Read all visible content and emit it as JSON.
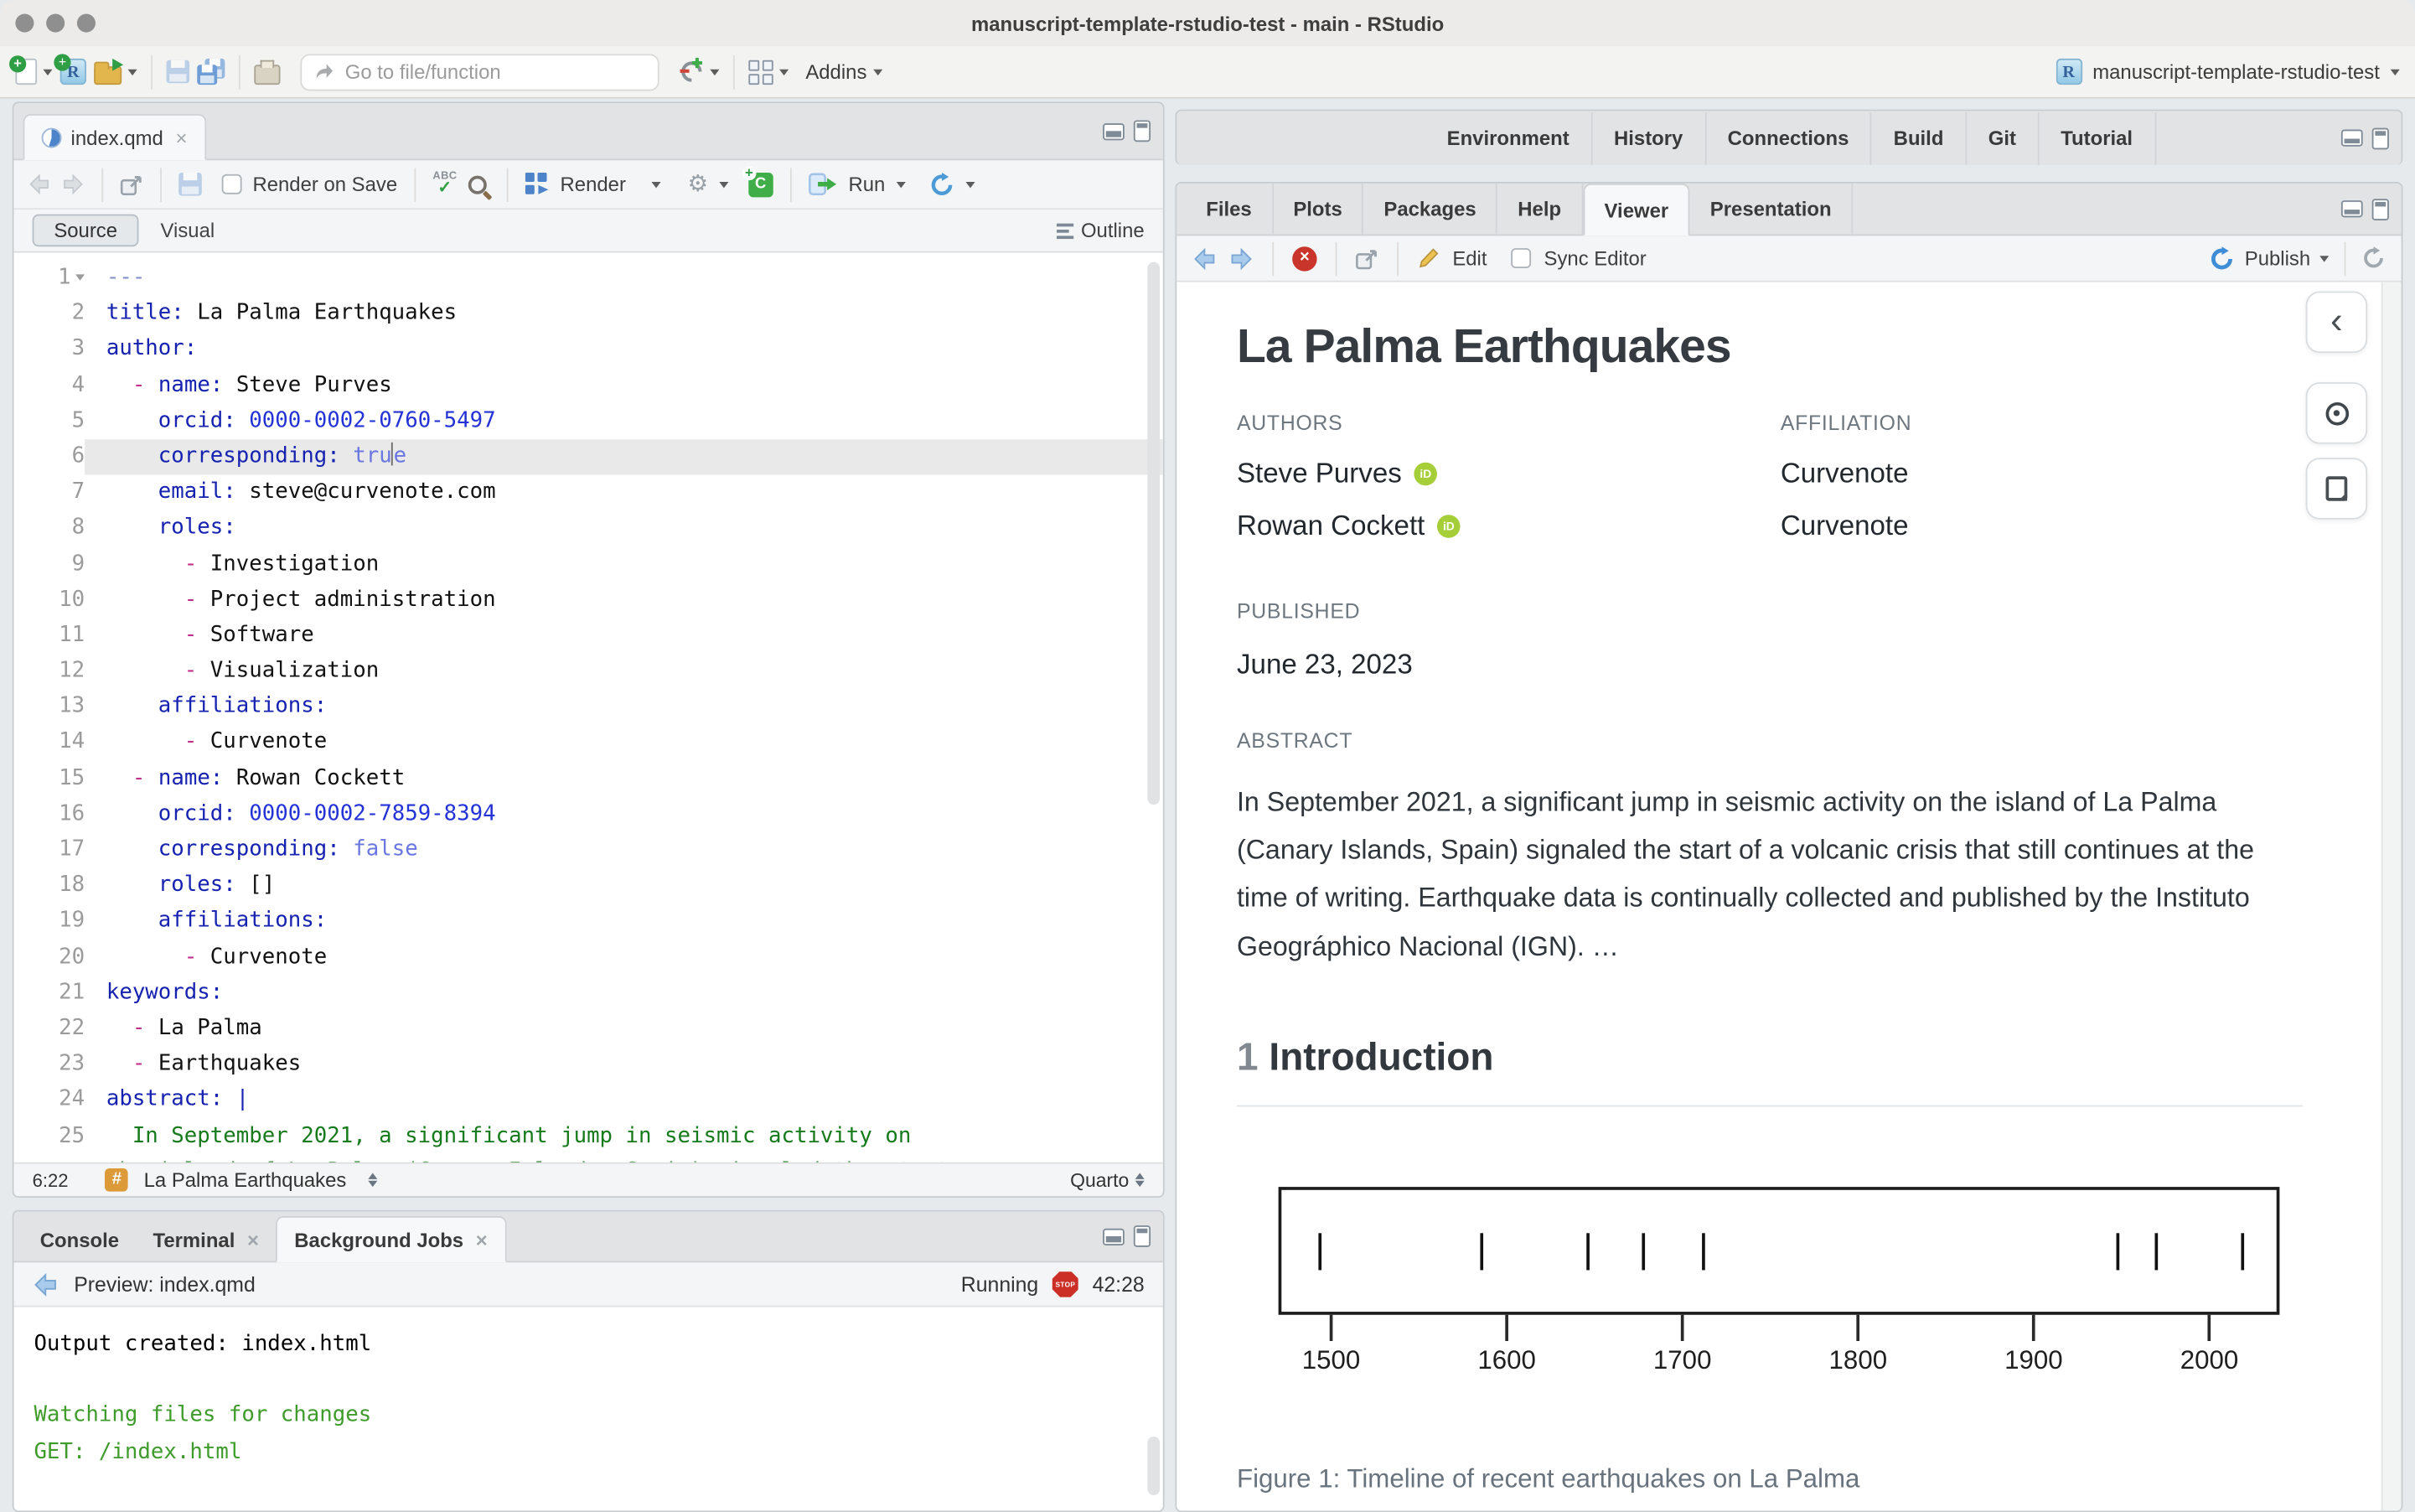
{
  "window": {
    "title": "manuscript-template-rstudio-test - main - RStudio"
  },
  "main_toolbar": {
    "goto_placeholder": "Go to file/function",
    "addins_label": "Addins",
    "project_name": "manuscript-template-rstudio-test"
  },
  "editor": {
    "tab_title": "index.qmd",
    "toolbar": {
      "render_on_save_label": "Render on Save",
      "render_label": "Render",
      "run_label": "Run"
    },
    "mode": {
      "source_label": "Source",
      "visual_label": "Visual",
      "outline_label": "Outline"
    },
    "status": {
      "cursor_position": "6:22",
      "section_label": "La Palma Earthquakes",
      "format_label": "Quarto"
    },
    "lines": [
      {
        "n": 1,
        "fold": true,
        "tokens": [
          {
            "t": "---",
            "c": "meta"
          }
        ]
      },
      {
        "n": 2,
        "tokens": [
          {
            "t": "title:",
            "c": "key"
          },
          {
            "t": " La Palma Earthquakes",
            "c": "plain"
          }
        ]
      },
      {
        "n": 3,
        "tokens": [
          {
            "t": "author:",
            "c": "key"
          }
        ]
      },
      {
        "n": 4,
        "tokens": [
          {
            "t": "  ",
            "c": "plain"
          },
          {
            "t": "-",
            "c": "dash"
          },
          {
            "t": " ",
            "c": "plain"
          },
          {
            "t": "name:",
            "c": "key"
          },
          {
            "t": " Steve Purves",
            "c": "plain"
          }
        ]
      },
      {
        "n": 5,
        "tokens": [
          {
            "t": "    ",
            "c": "plain"
          },
          {
            "t": "orcid:",
            "c": "key"
          },
          {
            "t": " ",
            "c": "plain"
          },
          {
            "t": "0000-0002-0760-5497",
            "c": "num"
          }
        ]
      },
      {
        "n": 6,
        "hl": true,
        "tokens": [
          {
            "t": "    ",
            "c": "plain"
          },
          {
            "t": "corresponding:",
            "c": "key"
          },
          {
            "t": " ",
            "c": "plain"
          },
          {
            "t": "tru",
            "c": "bool"
          },
          {
            "t": "",
            "c": "cursor"
          },
          {
            "t": "e",
            "c": "bool"
          }
        ]
      },
      {
        "n": 7,
        "tokens": [
          {
            "t": "    ",
            "c": "plain"
          },
          {
            "t": "email:",
            "c": "key"
          },
          {
            "t": " steve@curvenote.com",
            "c": "plain"
          }
        ]
      },
      {
        "n": 8,
        "tokens": [
          {
            "t": "    ",
            "c": "plain"
          },
          {
            "t": "roles:",
            "c": "key"
          }
        ]
      },
      {
        "n": 9,
        "tokens": [
          {
            "t": "      ",
            "c": "plain"
          },
          {
            "t": "-",
            "c": "dash"
          },
          {
            "t": " Investigation",
            "c": "plain"
          }
        ]
      },
      {
        "n": 10,
        "tokens": [
          {
            "t": "      ",
            "c": "plain"
          },
          {
            "t": "-",
            "c": "dash"
          },
          {
            "t": " Project administration",
            "c": "plain"
          }
        ]
      },
      {
        "n": 11,
        "tokens": [
          {
            "t": "      ",
            "c": "plain"
          },
          {
            "t": "-",
            "c": "dash"
          },
          {
            "t": " Software",
            "c": "plain"
          }
        ]
      },
      {
        "n": 12,
        "tokens": [
          {
            "t": "      ",
            "c": "plain"
          },
          {
            "t": "-",
            "c": "dash"
          },
          {
            "t": " Visualization",
            "c": "plain"
          }
        ]
      },
      {
        "n": 13,
        "tokens": [
          {
            "t": "    ",
            "c": "plain"
          },
          {
            "t": "affiliations:",
            "c": "key"
          }
        ]
      },
      {
        "n": 14,
        "tokens": [
          {
            "t": "      ",
            "c": "plain"
          },
          {
            "t": "-",
            "c": "dash"
          },
          {
            "t": " Curvenote",
            "c": "plain"
          }
        ]
      },
      {
        "n": 15,
        "tokens": [
          {
            "t": "  ",
            "c": "plain"
          },
          {
            "t": "-",
            "c": "dash"
          },
          {
            "t": " ",
            "c": "plain"
          },
          {
            "t": "name:",
            "c": "key"
          },
          {
            "t": " Rowan Cockett",
            "c": "plain"
          }
        ]
      },
      {
        "n": 16,
        "tokens": [
          {
            "t": "    ",
            "c": "plain"
          },
          {
            "t": "orcid:",
            "c": "key"
          },
          {
            "t": " ",
            "c": "plain"
          },
          {
            "t": "0000-0002-7859-8394",
            "c": "num"
          }
        ]
      },
      {
        "n": 17,
        "tokens": [
          {
            "t": "    ",
            "c": "plain"
          },
          {
            "t": "corresponding:",
            "c": "key"
          },
          {
            "t": " ",
            "c": "plain"
          },
          {
            "t": "false",
            "c": "bool"
          }
        ]
      },
      {
        "n": 18,
        "tokens": [
          {
            "t": "    ",
            "c": "plain"
          },
          {
            "t": "roles:",
            "c": "key"
          },
          {
            "t": " []",
            "c": "plain"
          }
        ]
      },
      {
        "n": 19,
        "tokens": [
          {
            "t": "    ",
            "c": "plain"
          },
          {
            "t": "affiliations:",
            "c": "key"
          }
        ]
      },
      {
        "n": 20,
        "tokens": [
          {
            "t": "      ",
            "c": "plain"
          },
          {
            "t": "-",
            "c": "dash"
          },
          {
            "t": " Curvenote",
            "c": "plain"
          }
        ]
      },
      {
        "n": 21,
        "tokens": [
          {
            "t": "keywords:",
            "c": "key"
          }
        ]
      },
      {
        "n": 22,
        "tokens": [
          {
            "t": "  ",
            "c": "plain"
          },
          {
            "t": "-",
            "c": "dash"
          },
          {
            "t": " La Palma",
            "c": "plain"
          }
        ]
      },
      {
        "n": 23,
        "tokens": [
          {
            "t": "  ",
            "c": "plain"
          },
          {
            "t": "-",
            "c": "dash"
          },
          {
            "t": " Earthquakes",
            "c": "plain"
          }
        ]
      },
      {
        "n": 24,
        "tokens": [
          {
            "t": "abstract:",
            "c": "key"
          },
          {
            "t": " ",
            "c": "plain"
          },
          {
            "t": "|",
            "c": "key"
          }
        ]
      },
      {
        "n": 25,
        "tokens": [
          {
            "t": "  In September 2021, a significant jump in seismic activity on",
            "c": "str"
          }
        ]
      },
      {
        "n": null,
        "tokens": [
          {
            "t": "the island of La Palma (Canary Islands, Spain) signaled the start",
            "c": "str"
          }
        ]
      }
    ]
  },
  "console": {
    "tabs": [
      {
        "label": "Console"
      },
      {
        "label": "Terminal",
        "closable": true
      },
      {
        "label": "Background Jobs",
        "closable": true,
        "active": true
      }
    ],
    "preview_label": "Preview: index.qmd",
    "status_label": "Running",
    "stop_label": "STOP",
    "elapsed_time": "42:28",
    "output": [
      {
        "text": "Output created: index.html",
        "color": "plain"
      },
      {
        "text": "",
        "color": "plain"
      },
      {
        "text": "Watching files for changes",
        "color": "green"
      },
      {
        "text": "GET: /index.html",
        "color": "green"
      }
    ]
  },
  "right_panel": {
    "top_tabs": [
      "Environment",
      "History",
      "Connections",
      "Build",
      "Git",
      "Tutorial"
    ],
    "viewer_tabs": [
      {
        "label": "Files"
      },
      {
        "label": "Plots"
      },
      {
        "label": "Packages"
      },
      {
        "label": "Help"
      },
      {
        "label": "Viewer",
        "active": true
      },
      {
        "label": "Presentation"
      }
    ],
    "viewer_toolbar": {
      "edit_label": "Edit",
      "sync_editor_label": "Sync Editor",
      "publish_label": "Publish"
    }
  },
  "doc": {
    "title": "La Palma Earthquakes",
    "authors_label": "AUTHORS",
    "affiliation_label": "AFFILIATION",
    "orcid_label": "iD",
    "authors": [
      {
        "name": "Steve Purves",
        "affiliation": "Curvenote"
      },
      {
        "name": "Rowan Cockett",
        "affiliation": "Curvenote"
      }
    ],
    "published_label": "PUBLISHED",
    "published": "June 23, 2023",
    "abstract_label": "ABSTRACT",
    "abstract": "In September 2021, a significant jump in seismic activity on the island of La Palma (Canary Islands, Spain) signaled the start of a volcanic crisis that still continues at the time of writing. Earthquake data is continually collected and published by the Instituto Geográphico Nacional (IGN). …",
    "section": {
      "number": "1",
      "title": "Introduction"
    },
    "figure_caption": "Figure 1: Timeline of recent earthquakes on La Palma"
  },
  "chart_data": {
    "type": "rug",
    "title": "Timeline of recent earthquakes on La Palma",
    "events_years": [
      1492,
      1585,
      1646,
      1677,
      1712,
      1949,
      1971,
      2021
    ],
    "x_ticks": [
      1500,
      1600,
      1700,
      1800,
      1900,
      2000
    ],
    "xlim": [
      1470,
      2040
    ],
    "xlabel": "",
    "ylabel": "",
    "grid": false,
    "legend": false
  },
  "colors": {
    "accent_blue": "#4693d3",
    "orcid_green": "#a6ce39",
    "console_green": "#3f9c2c",
    "running_stop_red": "#cc2f26",
    "chunk_green": "#3fae49",
    "hash_badge_orange": "#dd9a39"
  }
}
